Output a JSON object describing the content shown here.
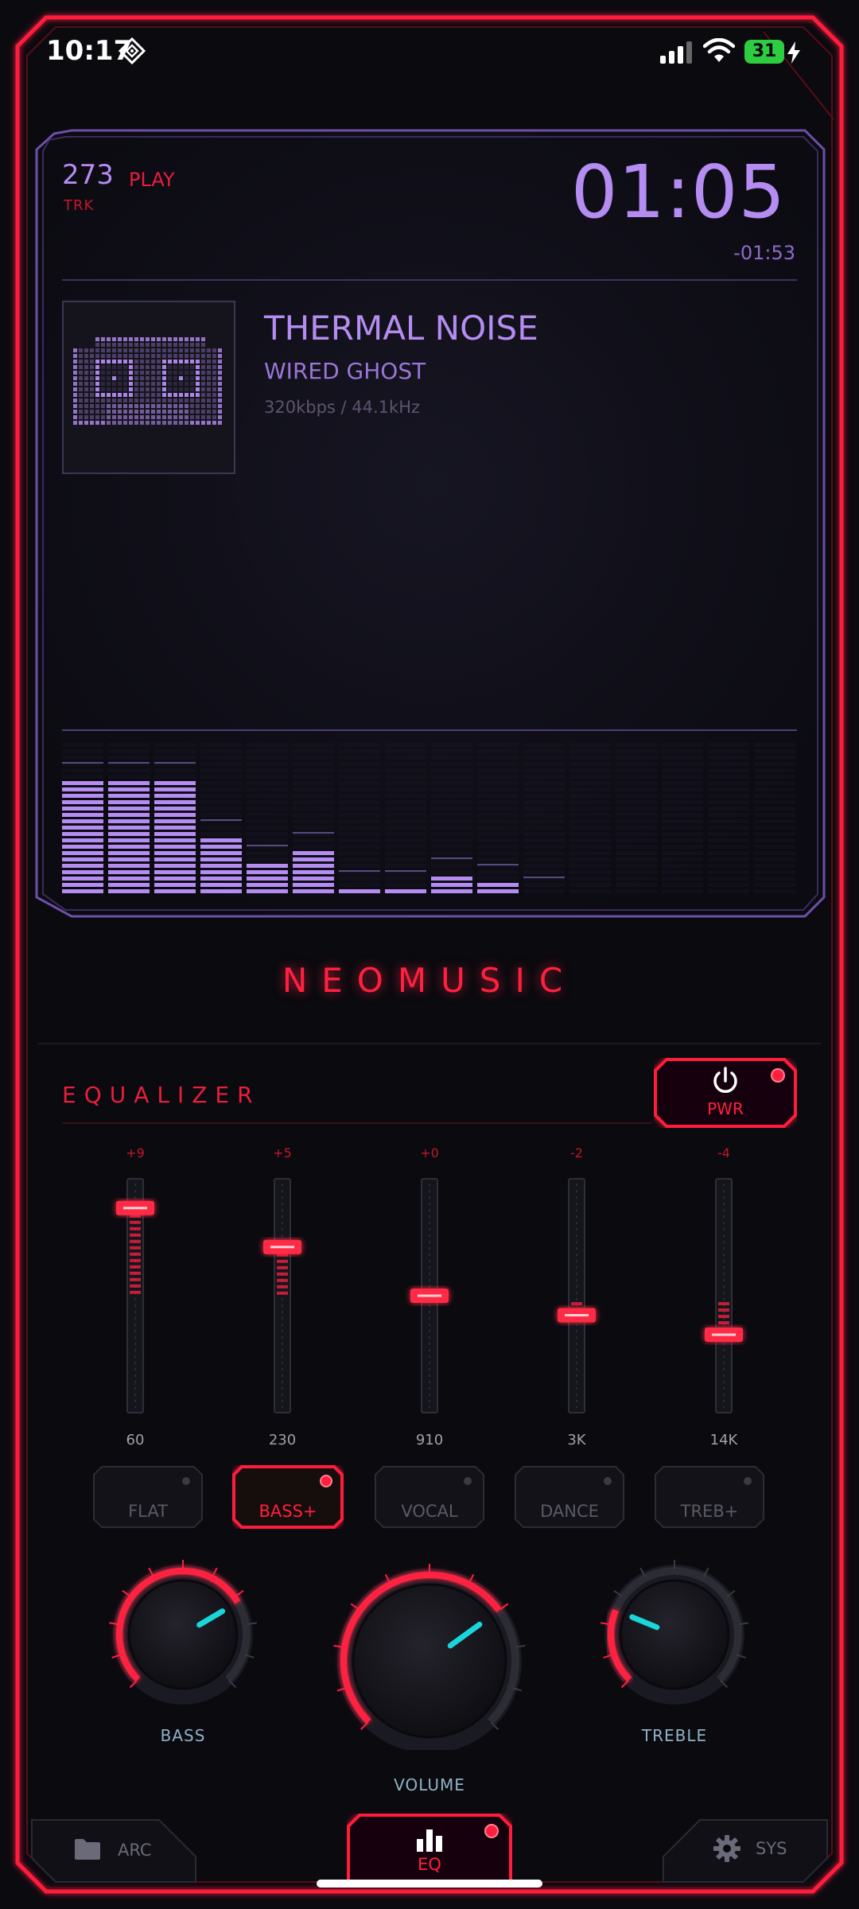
{
  "status_bar": {
    "time": "10:17",
    "battery_percent": "31",
    "icons": [
      "status-glyph-icon",
      "cellular-signal-icon",
      "wifi-icon",
      "battery-icon",
      "charging-bolt-icon"
    ]
  },
  "player": {
    "track_number": "273",
    "track_label": "TRK",
    "state": "PLAY",
    "elapsed": "01:05",
    "remaining": "-01:53",
    "title": "THERMAL NOISE",
    "artist": "WIRED GHOST",
    "quality": "320kbps / 44.1kHz",
    "spectrum_levels": [
      0.74,
      0.74,
      0.74,
      0.36,
      0.21,
      0.29,
      0.05,
      0.05,
      0.14,
      0.08,
      0.02,
      0.0,
      0.0,
      0.0,
      0.0,
      0.0
    ]
  },
  "app": {
    "brand": "NEOMUSIC"
  },
  "equalizer": {
    "title": "EQUALIZER",
    "power_label": "PWR",
    "power_on": true,
    "bands": [
      {
        "value": "+9",
        "freq": "60",
        "gain": 9
      },
      {
        "value": "+5",
        "freq": "230",
        "gain": 5
      },
      {
        "value": "+0",
        "freq": "910",
        "gain": 0
      },
      {
        "value": "-2",
        "freq": "3K",
        "gain": -2
      },
      {
        "value": "-4",
        "freq": "14K",
        "gain": -4
      }
    ],
    "presets": [
      {
        "label": "FLAT",
        "active": false
      },
      {
        "label": "BASS+",
        "active": true
      },
      {
        "label": "VOCAL",
        "active": false
      },
      {
        "label": "DANCE",
        "active": false
      },
      {
        "label": "TREB+",
        "active": false
      }
    ]
  },
  "knobs": {
    "bass": {
      "label": "BASS",
      "level": 0.72
    },
    "volume": {
      "label": "VOLUME",
      "level": 0.7
    },
    "treble": {
      "label": "TREBLE",
      "level": 0.25
    }
  },
  "nav": {
    "left": {
      "label": "ARC",
      "icon": "folder-icon"
    },
    "center": {
      "label": "EQ",
      "icon": "bar-chart-icon"
    },
    "right": {
      "label": "SYS",
      "icon": "gear-icon"
    }
  },
  "colors": {
    "accent_red": "#ff2040",
    "accent_purple": "#b48cf2",
    "cyan": "#1ad6dc",
    "background": "#0a0a0f"
  }
}
